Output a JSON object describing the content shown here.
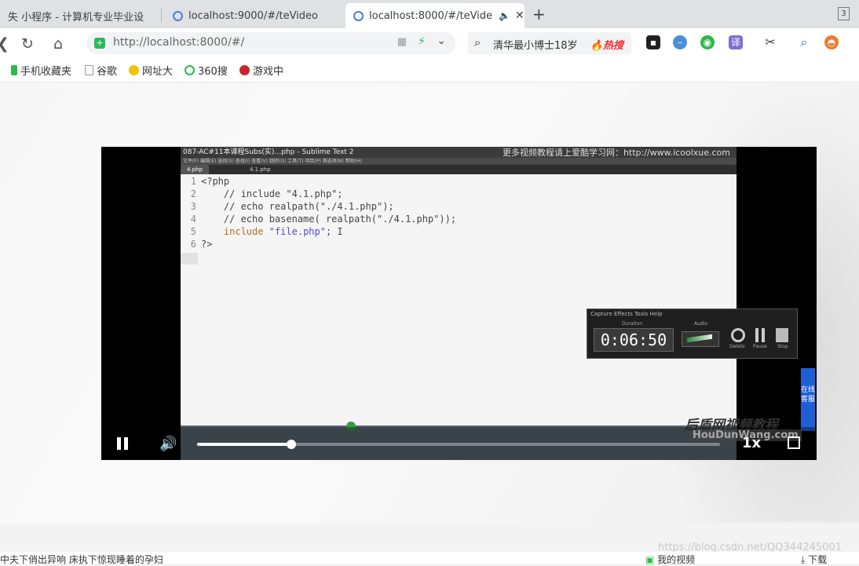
{
  "browser": {
    "tabs": [
      {
        "label": "失 小程序 - 计算机专业毕业设"
      },
      {
        "label": "localhost:9000/#/teVideo"
      },
      {
        "label": "localhost:8000/#/teVide"
      }
    ],
    "new_tab_label": "+",
    "tab_count": "3",
    "address": "http://localhost:8000/#/",
    "search_query": "清华最小博士18岁",
    "search_hot": "🔥热搜",
    "bookmarks": [
      "手机收藏夹",
      "谷歌",
      "网址大",
      "360搜",
      "游戏中"
    ]
  },
  "player": {
    "source_window_title": "087-AC#11本课程Subs(实)…php - Sublime Text 2",
    "source_banner": "更多视频教程请上爱酷学习网：http://www.icoolxue.com",
    "source_menu": "文件(F)  编辑(E)  选择(S)  查找(I)  查看(V)  跳转(G)  工具(T)  项目(P)  首选项(N)  帮助(H)",
    "source_tabs": [
      "4.php",
      "4.1.php"
    ],
    "code_lines": [
      {
        "n": "1",
        "text": "<?php"
      },
      {
        "n": "2",
        "text": "    // include \"4.1.php\";"
      },
      {
        "n": "3",
        "text": "    // echo realpath(\"./4.1.php\");"
      },
      {
        "n": "4",
        "text": "    // echo basename( realpath(\"./4.1.php\"));"
      },
      {
        "n": "5",
        "kw": "include",
        "str": "\"file.php\"",
        "rest": "; I"
      },
      {
        "n": "6",
        "text": "?>"
      }
    ],
    "recorder": {
      "menu": "Capture   Effects   Tools   Help",
      "duration_label": "Duration",
      "audio_label": "Audio",
      "time": "0:06:50",
      "btn_labels": [
        "Delete",
        "Pause",
        "Stop"
      ]
    },
    "side_tab_text": "在线客服",
    "watermark_cn": "后盾网视频教程",
    "watermark_en": "HouDunWang.com",
    "playback_speed": "1x",
    "progress_fraction": 0.18,
    "accent_color": "#ffffff"
  },
  "bottombar": {
    "news_ticker": "中夫下俏出异响 床执下惊现睡着的孕妇",
    "my_videos": "我的视频",
    "download": "下载"
  },
  "watermark_url": "https://blog.csdn.net/QQ344245001"
}
